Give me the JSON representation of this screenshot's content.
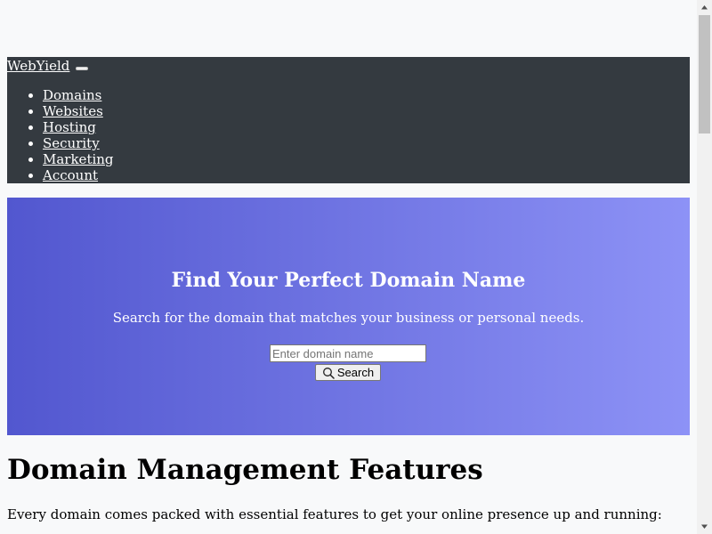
{
  "navbar": {
    "brand": "WebYield",
    "items": [
      {
        "label": "Domains"
      },
      {
        "label": "Websites"
      },
      {
        "label": "Hosting"
      },
      {
        "label": "Security"
      },
      {
        "label": "Marketing"
      },
      {
        "label": "Account"
      }
    ]
  },
  "hero": {
    "title": "Find Your Perfect Domain Name",
    "subtitle": "Search for the domain that matches your business or personal needs.",
    "search_placeholder": "Enter domain name",
    "search_value": "",
    "search_button_label": "Search",
    "search_button_icon": "search-icon",
    "gradient_start": "#5257cf",
    "gradient_end": "#8d92f6"
  },
  "features": {
    "title": "Domain Management Features",
    "description": "Every domain comes packed with essential features to get your online presence up and running:"
  },
  "colors": {
    "navbar_bg": "#343a40",
    "page_bg": "#f8f9fa"
  }
}
